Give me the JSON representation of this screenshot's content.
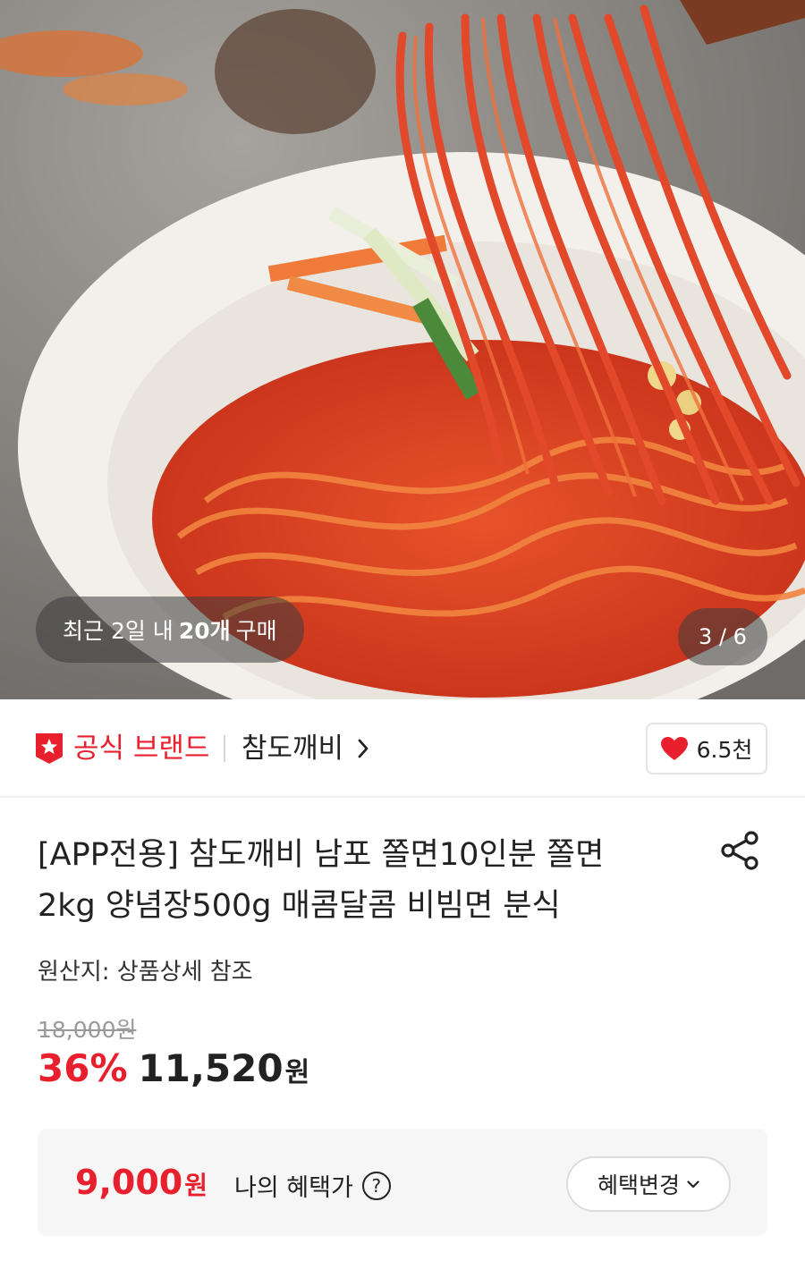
{
  "hero": {
    "recent_prefix": "최근 2일 내",
    "recent_count": "20개",
    "recent_suffix": "구매",
    "page_indicator": "3 / 6",
    "image_alt": "매콤한 양념의 비빔 쫄면"
  },
  "brand": {
    "official_label": "공식 브랜드",
    "name": "참도깨비",
    "like_count": "6.5천"
  },
  "product": {
    "title_line1": "[APP전용] 참도깨비 남포 쫄면10인분 쫄면",
    "title_line2": "2kg 양념장500g 매콤달콤 비빔면 분식",
    "origin": "원산지: 상품상세 참조",
    "original_price": "18,000원",
    "discount_rate": "36%",
    "sale_price": "11,520",
    "sale_unit": "원"
  },
  "benefit": {
    "price": "9,000",
    "unit": "원",
    "label": "나의 혜택가",
    "help_icon": "?",
    "change_button": "혜택변경"
  },
  "colors": {
    "accent": "#e8202e",
    "text": "#222222",
    "muted": "#9a9a9a",
    "box_bg": "#f6f6f6"
  }
}
